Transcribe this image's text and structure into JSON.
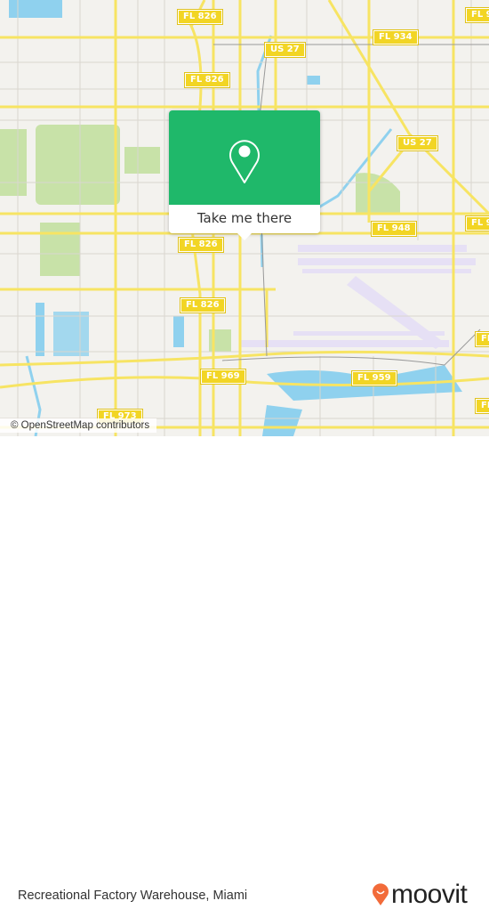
{
  "map": {
    "road_labels": [
      "FL 826",
      "FL 826",
      "FL 826",
      "FL 826",
      "US 27",
      "US 27",
      "FL 934",
      "FL 9",
      "FL 948",
      "FL 9",
      "FL 969",
      "FL 959",
      "FL 973",
      "FL",
      "FL"
    ],
    "attribution": "© OpenStreetMap contributors",
    "colors": {
      "land": "#f3f2ee",
      "road": "#f7e463",
      "water": "#8fd1ee",
      "park": "#c8e2a8",
      "airport": "#e6e0f5",
      "shield": "#f2d524"
    }
  },
  "popup": {
    "icon": "map-pin-icon",
    "button_label": "Take me there",
    "color": "#1fb86a"
  },
  "footer": {
    "place_name": "Recreational Factory Warehouse, Miami",
    "brand": "moovit",
    "brand_color": "#f26b3a"
  }
}
